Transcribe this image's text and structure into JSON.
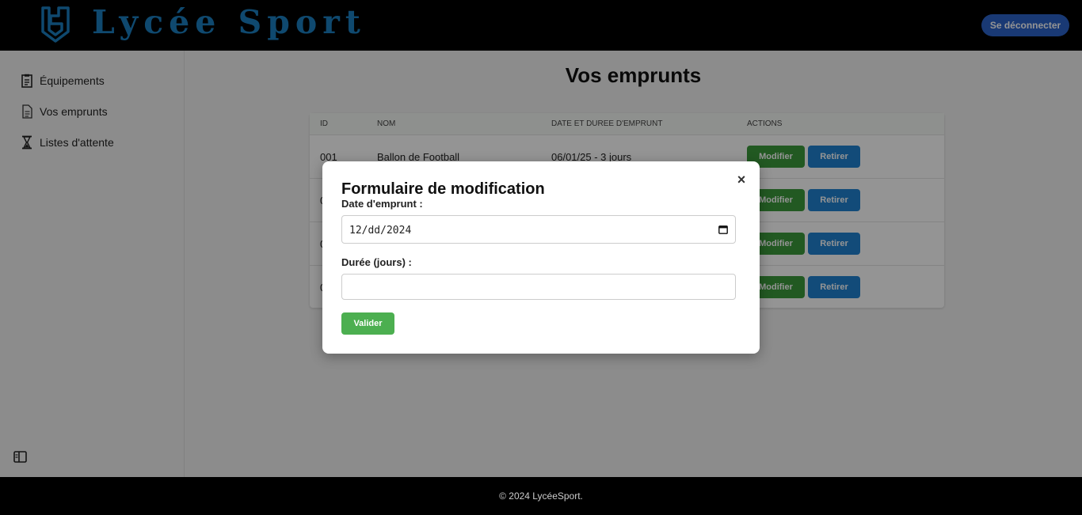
{
  "header": {
    "logo_text": "Lycée Sport",
    "logout_label": "Se déconnecter"
  },
  "sidebar": {
    "items": [
      {
        "label": "Équipements",
        "icon": "clipboard-icon"
      },
      {
        "label": "Vos emprunts",
        "icon": "document-icon"
      },
      {
        "label": "Listes d'attente",
        "icon": "hourglass-icon"
      }
    ],
    "toggle_icon": "sidebar-toggle-icon"
  },
  "main": {
    "title": "Vos emprunts",
    "table": {
      "headers": [
        "ID",
        "NOM",
        "DATE ET DUREE D'EMPRUNT",
        "ACTIONS"
      ],
      "rows": [
        {
          "id": "001",
          "nom": "Ballon de Football",
          "date": "06/01/25 - 3 jours"
        },
        {
          "id": "0",
          "nom": "",
          "date": ""
        },
        {
          "id": "0",
          "nom": "",
          "date": ""
        },
        {
          "id": "0",
          "nom": "",
          "date": ""
        }
      ],
      "modify_label": "Modifier",
      "remove_label": "Retirer"
    }
  },
  "modal": {
    "title": "Formulaire de modification",
    "close_label": "×",
    "date_label": "Date d'emprunt :",
    "date_value": "12/dd/2024",
    "duration_label": "Durée (jours) :",
    "duration_value": "",
    "submit_label": "Valider"
  },
  "footer": {
    "text": "© 2024 LycéeSport."
  },
  "colors": {
    "brand": "#1b7fc0",
    "logout": "#2c63c8",
    "modify": "#3c9a3c",
    "remove": "#1f82d1",
    "submit": "#4caf50"
  }
}
